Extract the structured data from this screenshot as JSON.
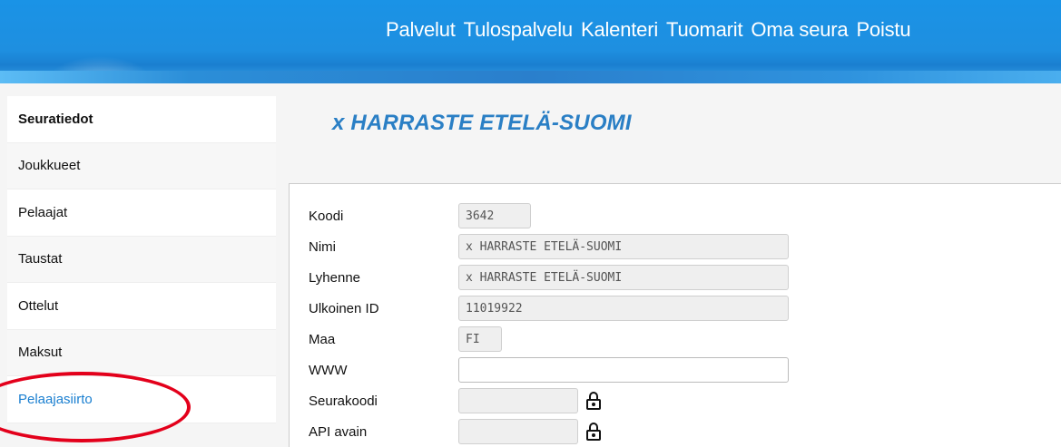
{
  "header": {
    "nav": [
      "Palvelut",
      "Tulospalvelu",
      "Kalenteri",
      "Tuomarit",
      "Oma seura",
      "Poistu"
    ]
  },
  "sidebar": {
    "items": [
      {
        "label": "Seuratiedot"
      },
      {
        "label": "Joukkueet"
      },
      {
        "label": "Pelaajat"
      },
      {
        "label": "Taustat"
      },
      {
        "label": "Ottelut"
      },
      {
        "label": "Maksut"
      },
      {
        "label": "Pelaajasiirto"
      }
    ]
  },
  "main": {
    "title": "x HARRASTE ETELÄ-SUOMI",
    "fields": {
      "koodi": {
        "label": "Koodi",
        "value": "3642"
      },
      "nimi": {
        "label": "Nimi",
        "value": "x HARRASTE ETELÄ-SUOMI"
      },
      "lyhenne": {
        "label": "Lyhenne",
        "value": "x HARRASTE ETELÄ-SUOMI"
      },
      "ulkoinen_id": {
        "label": "Ulkoinen ID",
        "value": "11019922"
      },
      "maa": {
        "label": "Maa",
        "value": "FI"
      },
      "www": {
        "label": "WWW",
        "value": ""
      },
      "seurakoodi": {
        "label": "Seurakoodi",
        "value": ""
      },
      "api_avain": {
        "label": "API avain",
        "value": ""
      }
    }
  },
  "colors": {
    "header_blue": "#1e8fe0",
    "title_blue": "#2a7fc5",
    "highlight_red": "#e3001b"
  },
  "icons": {
    "lock": "lock-icon"
  }
}
